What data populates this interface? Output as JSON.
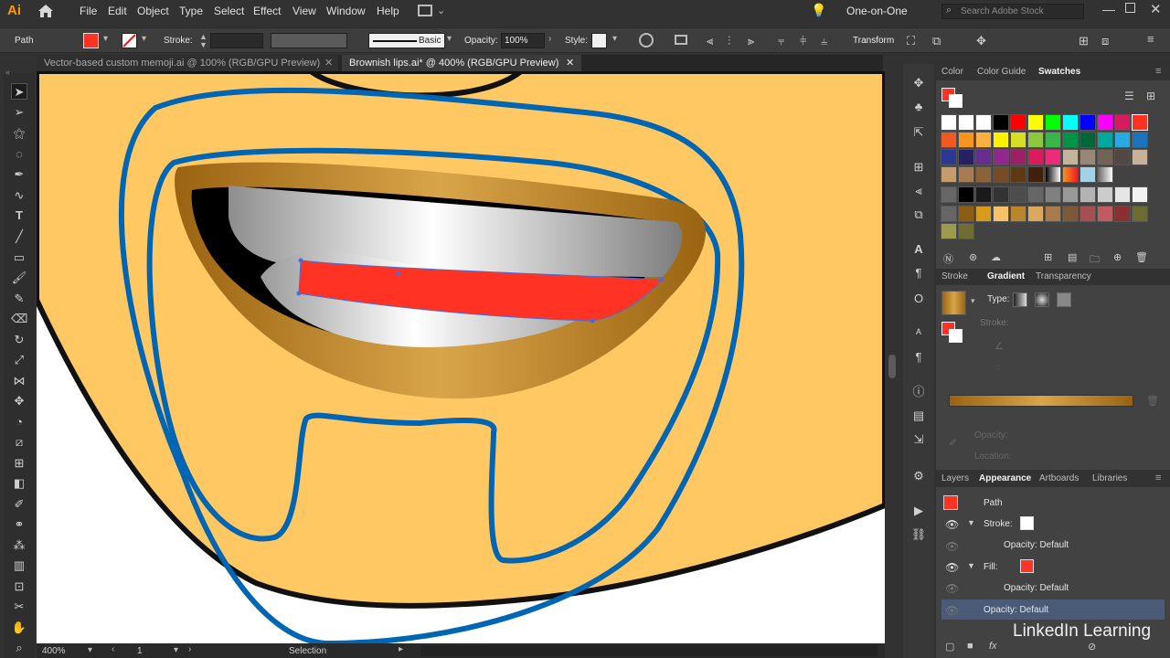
{
  "app": {
    "logo": "Ai",
    "workspace": "One-on-One",
    "search_placeholder": "Search Adobe Stock"
  },
  "menu": [
    "File",
    "Edit",
    "Object",
    "Type",
    "Select",
    "Effect",
    "View",
    "Window",
    "Help"
  ],
  "control": {
    "selection_type": "Path",
    "stroke_label": "Stroke:",
    "brush_label": "Basic",
    "opacity_label": "Opacity:",
    "opacity_value": "100%",
    "style_label": "Style:",
    "transform_label": "Transform"
  },
  "tabs": [
    {
      "label": "Vector-based custom memoji.ai @ 100% (RGB/GPU Preview)",
      "active": false
    },
    {
      "label": "Brownish lips.ai* @ 400% (RGB/GPU Preview)",
      "active": true
    }
  ],
  "status": {
    "zoom": "400%",
    "artboard": "1",
    "tool": "Selection"
  },
  "colors": {
    "face": "#FFC862",
    "blue_outline": "#0066B3",
    "lip_gold_dark": "#9A6311",
    "lip_gold_light": "#D9A54A",
    "tongue_red": "#FF3224",
    "panel_bg": "#424242"
  },
  "swatches_panel": {
    "tabs": [
      "Color",
      "Color Guide",
      "Swatches"
    ],
    "active": "Swatches"
  },
  "gradient_panel": {
    "tabs": [
      "Stroke",
      "Gradient",
      "Transparency"
    ],
    "active": "Gradient",
    "type_label": "Type:",
    "stroke_label": "Stroke:",
    "opacity_label": "Opacity:",
    "location_label": "Location:"
  },
  "appearance_panel": {
    "tabs": [
      "Layers",
      "Appearance",
      "Artboards",
      "Libraries"
    ],
    "active": "Appearance",
    "path_label": "Path",
    "stroke_label": "Stroke:",
    "stroke_opacity": "Opacity: Default",
    "fill_label": "Fill:",
    "fill_opacity": "Opacity: Default",
    "object_opacity": "Opacity: Default"
  },
  "watermark": "LinkedIn Learning"
}
